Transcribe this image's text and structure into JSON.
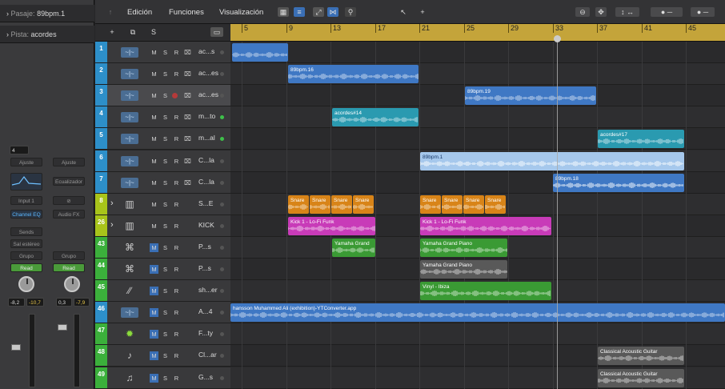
{
  "inspector": {
    "region_label": "Pasaje:",
    "region_value": "89bpm.1",
    "track_label": "Pista:",
    "track_value": "acordes",
    "strip_left": {
      "voices": "4",
      "ajuste": "Ajuste",
      "eq": "",
      "input": "Input 1",
      "plugin": "Channel EQ",
      "sends": "Sends",
      "output": "Sal estéreo",
      "group": "Grupo",
      "automation": "Read",
      "pan_left": "-8,2",
      "pan_right": "-10,7"
    },
    "strip_right": {
      "ajuste": "Ajuste",
      "eq": "Ecualizador",
      "plugin": "Audio FX",
      "group": "Grupo",
      "automation": "Read",
      "pan_left": "0,3",
      "pan_right": "-7,9"
    }
  },
  "toolbar": {
    "edit": "Edición",
    "functions": "Funciones",
    "view": "Visualización"
  },
  "ruler": {
    "bars": [
      "5",
      "9",
      "13",
      "17",
      "21",
      "25",
      "29",
      "33",
      "37",
      "41",
      "45"
    ]
  },
  "colors": {
    "ruler": "#c4a43a",
    "audio_blue": "#3f78c4",
    "light_blue": "#7fb2e3",
    "teal": "#2a9ab0",
    "orange": "#d88418",
    "magenta": "#c83bb8",
    "green": "#3a9a34",
    "gray": "#595959"
  },
  "tracks": [
    {
      "num": "1",
      "name": "ac...s",
      "icon": "waveform-icon",
      "color": "#2d8fc9",
      "led": "#555"
    },
    {
      "num": "2",
      "name": "ac...es",
      "icon": "waveform-icon",
      "color": "#2d8fc9",
      "led": "#555"
    },
    {
      "num": "3",
      "name": "ac...es",
      "icon": "waveform-icon",
      "color": "#2d8fc9",
      "led": "#555"
    },
    {
      "num": "4",
      "name": "m...to",
      "icon": "waveform-icon",
      "color": "#2d8fc9",
      "led": "#3ec04a"
    },
    {
      "num": "5",
      "name": "m...al",
      "icon": "waveform-icon",
      "color": "#2d8fc9",
      "led": "#3ec04a"
    },
    {
      "num": "6",
      "name": "C...la",
      "icon": "waveform-icon",
      "color": "#2d8fc9",
      "led": "#555"
    },
    {
      "num": "7",
      "name": "C...la",
      "icon": "waveform-icon",
      "color": "#2d8fc9",
      "led": "#555"
    },
    {
      "num": "8",
      "name": "S...E",
      "icon": "drum-machine-icon",
      "color": "#a8c41a",
      "led": "#555"
    },
    {
      "num": "26",
      "name": "KICK",
      "icon": "drum-machine-icon",
      "color": "#a8c41a",
      "led": "#555"
    },
    {
      "num": "43",
      "name": "P...s",
      "icon": "piano-icon",
      "color": "#3bb03b",
      "led": "#555"
    },
    {
      "num": "44",
      "name": "P...s",
      "icon": "piano-icon",
      "color": "#3bb03b",
      "led": "#555"
    },
    {
      "num": "45",
      "name": "sh...er",
      "icon": "shaker-icon",
      "color": "#3bb03b",
      "led": "#555"
    },
    {
      "num": "46",
      "name": "A...4",
      "icon": "waveform-icon",
      "color": "#2d8fc9",
      "led": "#555"
    },
    {
      "num": "47",
      "name": "F...ty",
      "icon": "gear-icon",
      "color": "#3bb03b",
      "led": "#555"
    },
    {
      "num": "48",
      "name": "Cl...ar",
      "icon": "guitar-icon",
      "color": "#3bb03b",
      "led": "#555"
    },
    {
      "num": "49",
      "name": "G...s",
      "icon": "guitarist-icon",
      "color": "#3bb03b",
      "led": "#555"
    }
  ],
  "regions": [
    {
      "id": "r1",
      "name": "",
      "color": "#3f78c4"
    },
    {
      "id": "r2",
      "name": "89bpm.16",
      "color": "#3f78c4"
    },
    {
      "id": "r3",
      "name": "89bpm.19",
      "color": "#3f78c4"
    },
    {
      "id": "r4",
      "name": "acordes#14",
      "color": "#2a9ab0"
    },
    {
      "id": "r5",
      "name": "acordes#17",
      "color": "#2a9ab0"
    },
    {
      "id": "r6",
      "name": "89bpm.1",
      "color": "#a6c8ec"
    },
    {
      "id": "r7",
      "name": "89bpm.18",
      "color": "#3f78c4"
    },
    {
      "id": "r8a",
      "name": "Snare",
      "color": "#d88418"
    },
    {
      "id": "r8b",
      "name": "Snare",
      "color": "#d88418"
    },
    {
      "id": "r8c",
      "name": "Snare",
      "color": "#d88418"
    },
    {
      "id": "r8d",
      "name": "Snare",
      "color": "#d88418"
    },
    {
      "id": "r8e",
      "name": "Snare",
      "color": "#d88418"
    },
    {
      "id": "r8f",
      "name": "Snare",
      "color": "#d88418"
    },
    {
      "id": "r8g",
      "name": "Snare",
      "color": "#d88418"
    },
    {
      "id": "r8h",
      "name": "Snare",
      "color": "#d88418"
    },
    {
      "id": "r9a",
      "name": "Kick 1 - Lo-Fi Funk",
      "color": "#c83bb8"
    },
    {
      "id": "r9b",
      "name": "Kick 1 - Lo-Fi Funk",
      "color": "#c83bb8"
    },
    {
      "id": "r10a",
      "name": "Yamaha Grand",
      "color": "#3a9a34"
    },
    {
      "id": "r10b",
      "name": "Yamaha Grand Piano",
      "color": "#3a9a34"
    },
    {
      "id": "r11",
      "name": "Yamaha Grand Piano",
      "color": "#595959"
    },
    {
      "id": "r12",
      "name": "Vinyl - Ibiza",
      "color": "#3a9a34"
    },
    {
      "id": "r13",
      "name": "hansson  Muhammed Ali (exhibition)-YTConverter.app",
      "color": "#3f78c4"
    },
    {
      "id": "r15a",
      "name": "Classical Acoustic Guitar",
      "color": "#595959"
    },
    {
      "id": "r15b",
      "name": "Classical Acoustic Guitar",
      "color": "#595959"
    }
  ]
}
